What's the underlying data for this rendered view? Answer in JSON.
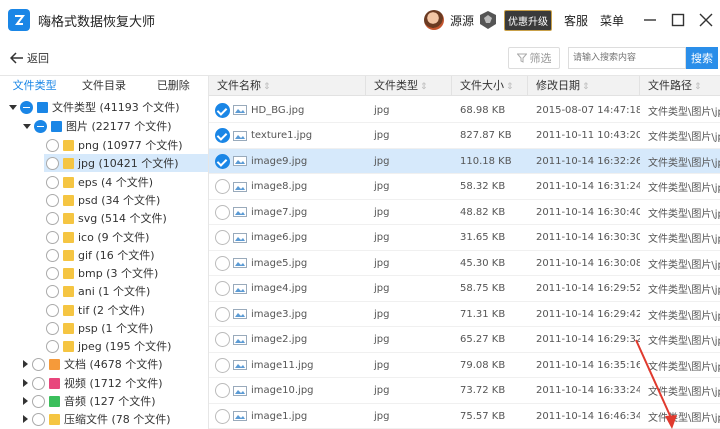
{
  "app": {
    "title": "嗨格式数据恢复大师"
  },
  "header": {
    "username": "源源",
    "upgrade_label": "优惠升级",
    "service_label": "客服",
    "menu_label": "菜单"
  },
  "toolbar": {
    "back_label": "返回",
    "filter_label": "筛选",
    "search_placeholder": "请输入搜索内容",
    "search_button": "搜索"
  },
  "left_tabs": [
    "文件类型",
    "文件目录",
    "已删除"
  ],
  "tree": [
    {
      "label": "文件类型 (41193 个文件)"
    },
    {
      "label": "图片 (22177 个文件)"
    },
    {
      "label": "png (10977 个文件)"
    },
    {
      "label": "jpg (10421 个文件)"
    },
    {
      "label": "eps (4 个文件)"
    },
    {
      "label": "psd (34 个文件)"
    },
    {
      "label": "svg (514 个文件)"
    },
    {
      "label": "ico (9 个文件)"
    },
    {
      "label": "gif (16 个文件)"
    },
    {
      "label": "bmp (3 个文件)"
    },
    {
      "label": "ani (1 个文件)"
    },
    {
      "label": "tif (2 个文件)"
    },
    {
      "label": "psp (1 个文件)"
    },
    {
      "label": "jpeg (195 个文件)"
    },
    {
      "label": "文档 (4678 个文件)"
    },
    {
      "label": "视频 (1712 个文件)"
    },
    {
      "label": "音频 (127 个文件)"
    },
    {
      "label": "压缩文件 (78 个文件)"
    }
  ],
  "table": {
    "headers": [
      "文件名称",
      "文件类型",
      "文件大小",
      "修改日期",
      "文件路径"
    ],
    "rows": [
      {
        "name": "HD_BG.jpg",
        "type": "jpg",
        "size": "68.98 KB",
        "date": "2015-08-07 14:47:18",
        "path": "文件类型\\图片\\jpg\\"
      },
      {
        "name": "texture1.jpg",
        "type": "jpg",
        "size": "827.87 KB",
        "date": "2011-10-11 10:43:20",
        "path": "文件类型\\图片\\jpg\\"
      },
      {
        "name": "image9.jpg",
        "type": "jpg",
        "size": "110.18 KB",
        "date": "2011-10-14 16:32:26",
        "path": "文件类型\\图片\\jpg\\"
      },
      {
        "name": "image8.jpg",
        "type": "jpg",
        "size": "58.32 KB",
        "date": "2011-10-14 16:31:24",
        "path": "文件类型\\图片\\jpg\\"
      },
      {
        "name": "image7.jpg",
        "type": "jpg",
        "size": "48.82 KB",
        "date": "2011-10-14 16:30:40",
        "path": "文件类型\\图片\\jpg\\"
      },
      {
        "name": "image6.jpg",
        "type": "jpg",
        "size": "31.65 KB",
        "date": "2011-10-14 16:30:30",
        "path": "文件类型\\图片\\jpg\\"
      },
      {
        "name": "image5.jpg",
        "type": "jpg",
        "size": "45.30 KB",
        "date": "2011-10-14 16:30:08",
        "path": "文件类型\\图片\\jpg\\"
      },
      {
        "name": "image4.jpg",
        "type": "jpg",
        "size": "58.75 KB",
        "date": "2011-10-14 16:29:52",
        "path": "文件类型\\图片\\jpg\\"
      },
      {
        "name": "image3.jpg",
        "type": "jpg",
        "size": "71.31 KB",
        "date": "2011-10-14 16:29:42",
        "path": "文件类型\\图片\\jpg\\"
      },
      {
        "name": "image2.jpg",
        "type": "jpg",
        "size": "65.27 KB",
        "date": "2011-10-14 16:29:32",
        "path": "文件类型\\图片\\jpg\\"
      },
      {
        "name": "image11.jpg",
        "type": "jpg",
        "size": "79.08 KB",
        "date": "2011-10-14 16:35:16",
        "path": "文件类型\\图片\\jpg\\"
      },
      {
        "name": "image10.jpg",
        "type": "jpg",
        "size": "73.72 KB",
        "date": "2011-10-14 16:33:24",
        "path": "文件类型\\图片\\jpg\\"
      },
      {
        "name": "image1.jpg",
        "type": "jpg",
        "size": "75.57 KB",
        "date": "2011-10-14 16:46:34",
        "path": "文件类型\\图片\\jpg\\"
      }
    ]
  },
  "colors": {
    "accent": "#1a86e6",
    "selected_row": "#d6e9fb",
    "annotation_arrow": "#e03a2e"
  },
  "icons": [
    "app-logo-icon",
    "shield-rank-icon",
    "minimize-icon",
    "maximize-icon",
    "close-icon",
    "back-arrow-icon",
    "filter-icon",
    "image-file-icon",
    "folder-icon",
    "check-icon"
  ]
}
